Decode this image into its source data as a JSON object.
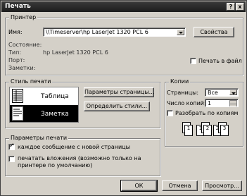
{
  "window": {
    "title": "Печать",
    "help_btn": "?",
    "close_btn": "x"
  },
  "printer": {
    "legend": "Принтер",
    "name_label": "Имя:",
    "name_value": "\\\\Timeserver\\hp LaserJet 1320 PCL 6",
    "properties_btn": "Свойства",
    "status_label": "Состояние:",
    "status_value": "",
    "type_label": "Тип:",
    "type_value": "hp LaserJet 1320 PCL 6",
    "port_label": "Порт:",
    "port_value": "",
    "comment_label": "Заметки:",
    "comment_value": "",
    "print_to_file": {
      "label": "Печать в файл",
      "checked": false
    }
  },
  "print_style": {
    "legend": "Стиль печати",
    "items": [
      {
        "label": "Таблица",
        "selected": false
      },
      {
        "label": "Заметка",
        "selected": true
      }
    ],
    "page_setup_btn": "Параметры страницы...",
    "define_styles_btn": "Определить стили..."
  },
  "copies": {
    "legend": "Копии",
    "pages_label": "Страницы:",
    "pages_value": "Все",
    "count_label": "Число копий:",
    "count_value": "1",
    "collate": {
      "label": "Разобрать по копиям",
      "checked": false
    },
    "collate_numbers": [
      "1",
      "1",
      "2",
      "2",
      "3",
      "3"
    ]
  },
  "options": {
    "legend": "Параметры печати",
    "new_page": {
      "label": "каждое сообщение с новой страницы",
      "checked": true
    },
    "attachments": {
      "label_line1": "печатать вложения (возможно только на",
      "label_line2": "принтере по умолчанию)",
      "checked": false
    }
  },
  "buttons": {
    "ok": "ОК",
    "cancel": "Отмена",
    "preview": "Просмотр..."
  },
  "colors": {
    "title_bar": "#2a2a2a",
    "dialog_bg": "#d4d0c8",
    "selection": "#000000"
  }
}
